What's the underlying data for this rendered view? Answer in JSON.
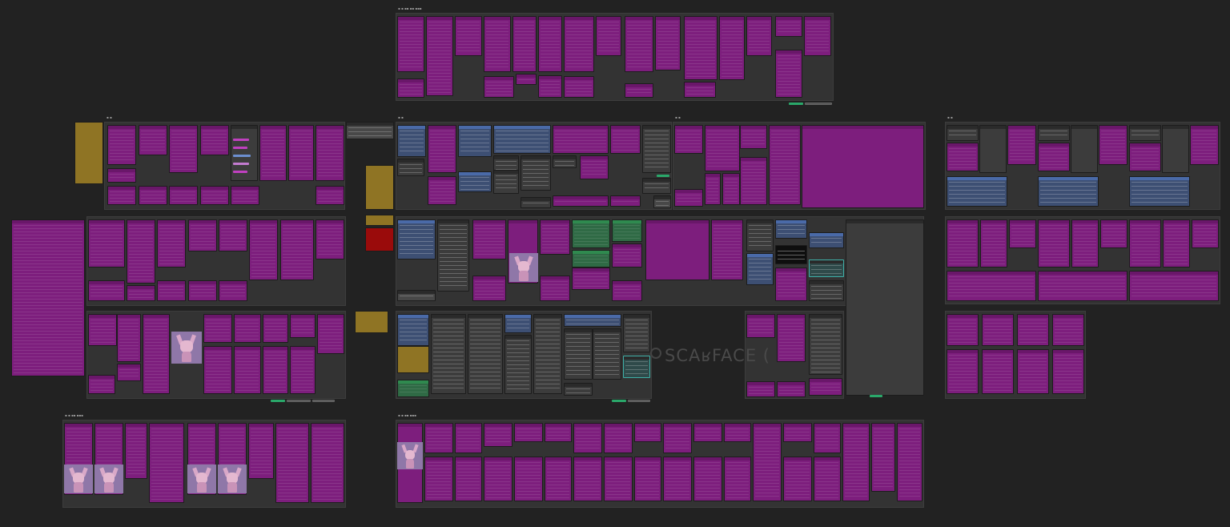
{
  "canvas": {
    "app": "node graph canvas",
    "background": "#222222",
    "watermark": "SCAʁFACE ("
  },
  "groups": [
    {
      "id": "g-top",
      "title": "▪ ▪ ▪▪ ▪▪ ▪▪▪"
    },
    {
      "id": "g-left-a",
      "title": "▪ ▪"
    },
    {
      "id": "g-left-b",
      "title": ""
    },
    {
      "id": "g-left-c",
      "title": ""
    },
    {
      "id": "g-mid-a",
      "title": "▪ ▪"
    },
    {
      "id": "g-mid-b",
      "title": "▪ ▪"
    },
    {
      "id": "g-right-a",
      "title": "▪ ▪"
    },
    {
      "id": "g-right-b",
      "title": ""
    },
    {
      "id": "g-right-c",
      "title": ""
    },
    {
      "id": "g-bot-left",
      "title": "▪ ▪ ▪▪ ▪▪▪"
    },
    {
      "id": "g-bot-mid",
      "title": "▪ ▪ ▪▪ ▪▪▪"
    },
    {
      "id": "g-center-low",
      "title": ""
    },
    {
      "id": "g-center-main",
      "title": ""
    },
    {
      "id": "g-center-right",
      "title": ""
    }
  ],
  "colors": {
    "muted_node": "#7d1e7d",
    "active_node": "#3c3c3c",
    "blue_node": "#3d4f73",
    "green_node": "#2f6a45",
    "gold_node": "#8f7424",
    "red_node": "#9a0b0b",
    "queue_button": "#2aa86a"
  }
}
